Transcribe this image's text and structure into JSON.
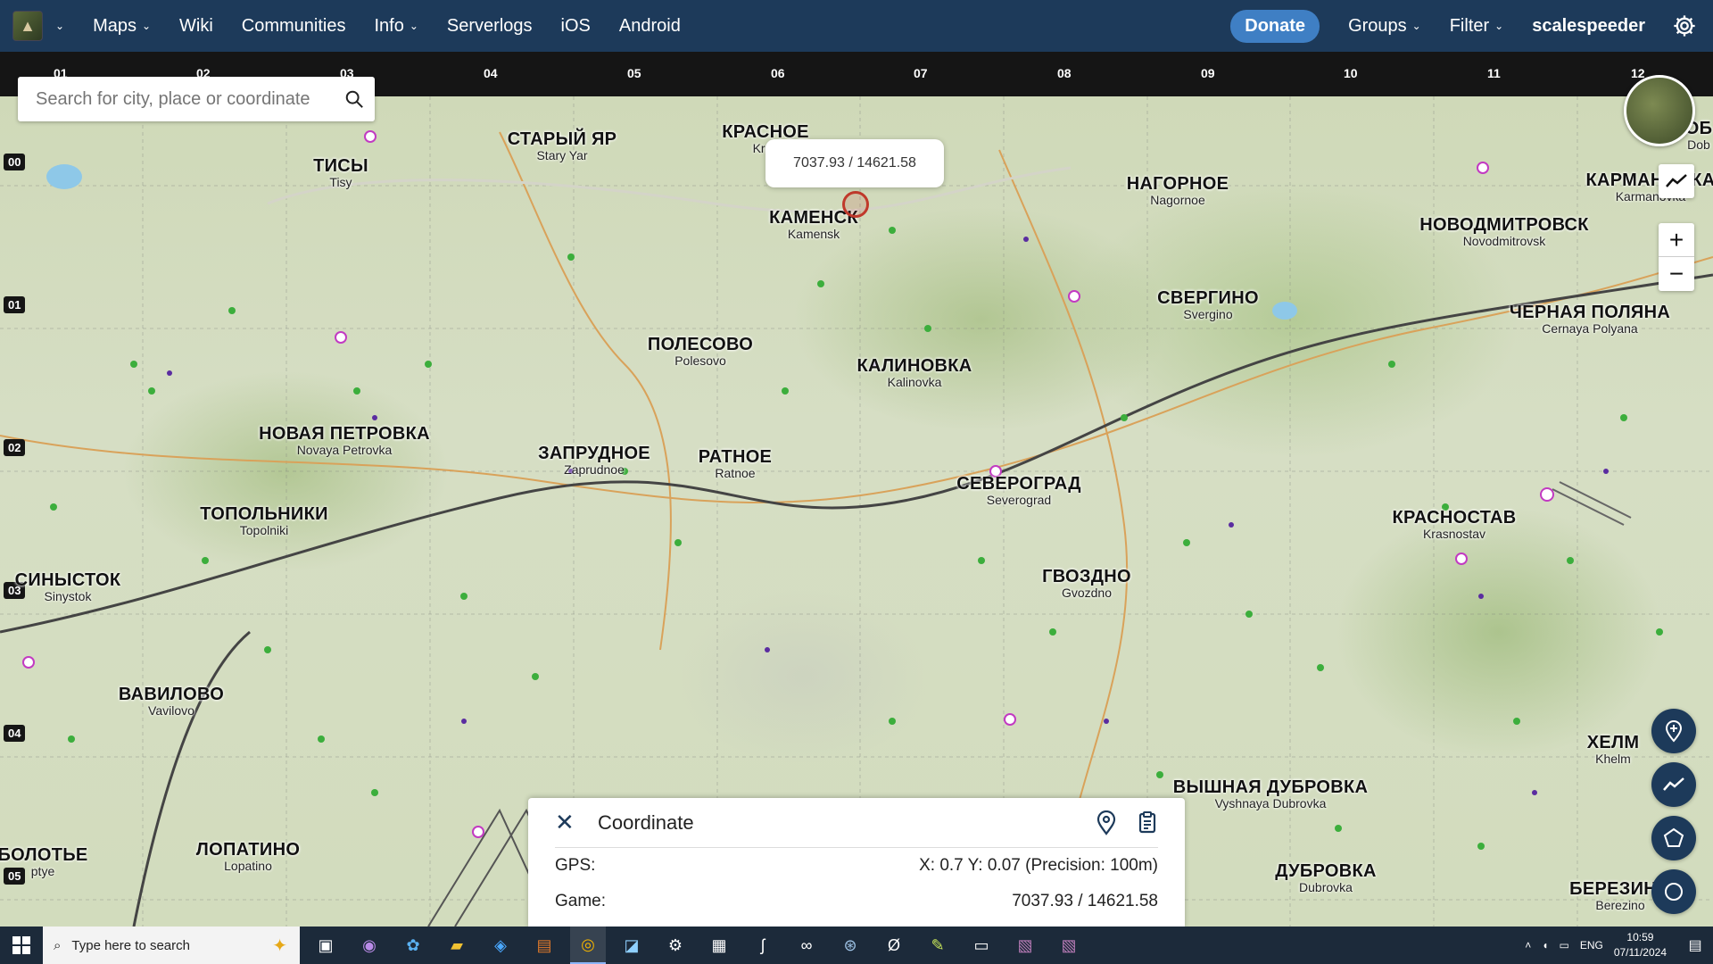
{
  "nav": {
    "maps": "Maps",
    "wiki": "Wiki",
    "communities": "Communities",
    "info": "Info",
    "serverlogs": "Serverlogs",
    "ios": "iOS",
    "android": "Android",
    "donate": "Donate",
    "groups": "Groups",
    "filter": "Filter",
    "username": "scalespeeder"
  },
  "grid": {
    "columns": [
      "01",
      "02",
      "03",
      "04",
      "05",
      "06",
      "07",
      "08",
      "09",
      "10",
      "11",
      "12"
    ],
    "rows": [
      "00",
      "01",
      "02",
      "03",
      "04",
      "05"
    ]
  },
  "search": {
    "placeholder": "Search for city, place or coordinate"
  },
  "tooltip": {
    "text": "7037.93 / 14621.58"
  },
  "towns": [
    {
      "ru": "СТАРЫЙ ЯР",
      "en": "Stary Yar"
    },
    {
      "ru": "КРАСНОЕ",
      "en": "Kras"
    },
    {
      "ru": "ТИСЫ",
      "en": "Tisy"
    },
    {
      "ru": "КАМЕНСК",
      "en": "Kamensk"
    },
    {
      "ru": "НАГОРНОЕ",
      "en": "Nagornoe"
    },
    {
      "ru": "НОВОДМИТРОВСК",
      "en": "Novodmitrovsk"
    },
    {
      "ru": "КАРМАНОВКА",
      "en": "Karmanovka"
    },
    {
      "ru": "СВЕРГИНО",
      "en": "Svergino"
    },
    {
      "ru": "ЧЕРНАЯ ПОЛЯНА",
      "en": "Cernaya Polyana"
    },
    {
      "ru": "ПОЛЕСОВО",
      "en": "Polesovo"
    },
    {
      "ru": "КАЛИНОВКА",
      "en": "Kalinovka"
    },
    {
      "ru": "НОВАЯ ПЕТРОВКА",
      "en": "Novaya Petrovka"
    },
    {
      "ru": "ЗАПРУДНОЕ",
      "en": "Zaprudnoe"
    },
    {
      "ru": "РАТНОЕ",
      "en": "Ratnoe"
    },
    {
      "ru": "СЕВЕРОГРАД",
      "en": "Severograd"
    },
    {
      "ru": "ТОПОЛЬНИКИ",
      "en": "Topolniki"
    },
    {
      "ru": "КРАСНОСТАВ",
      "en": "Krasnostav"
    },
    {
      "ru": "СИНЫСТОК",
      "en": "Sinystok"
    },
    {
      "ru": "ГВОЗДНО",
      "en": "Gvozdno"
    },
    {
      "ru": "ВАВИЛОВО",
      "en": "Vavilovo"
    },
    {
      "ru": "ХЕЛМ",
      "en": "Khelm"
    },
    {
      "ru": "ВЫШНАЯ ДУБРОВКА",
      "en": "Vyshnaya Dubrovka"
    },
    {
      "ru": "ЛОПАТИНО",
      "en": "Lopatino"
    },
    {
      "ru": "БОЛОТЬЕ",
      "en": "ptye"
    },
    {
      "ru": "ДУБРОВКА",
      "en": "Dubrovka"
    },
    {
      "ru": "БЕРЕЗИНО",
      "en": "Berezino"
    },
    {
      "ru": "ОБ",
      "en": "Dob"
    }
  ],
  "panel": {
    "title": "Coordinate",
    "gps_label": "GPS:",
    "gps_value": "X: 0.7 Y:  0.07 (Precision:  100m)",
    "game_label": "Game:",
    "game_value": "7037.93 / 14621.58"
  },
  "taskbar": {
    "search_placeholder": "Type here to search",
    "lang": "ENG",
    "time": "10:59",
    "date": "07/11/2024"
  }
}
